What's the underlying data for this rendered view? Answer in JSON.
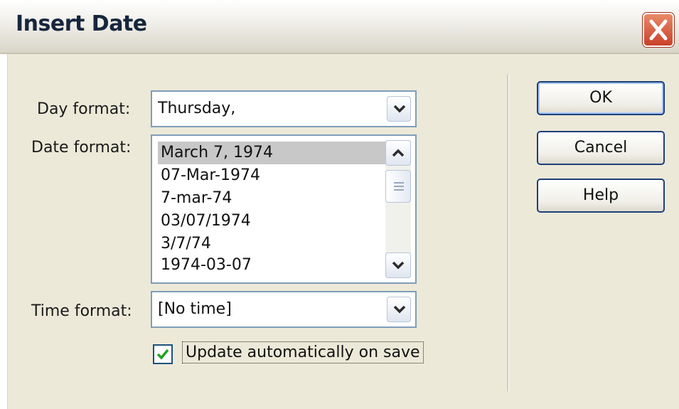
{
  "window": {
    "title": "Insert Date"
  },
  "day_format": {
    "label": "Day format:",
    "value": "Thursday,"
  },
  "date_format": {
    "label": "Date format:",
    "options": [
      "March 7, 1974",
      "07-Mar-1974",
      "7-mar-74",
      "03/07/1974",
      "3/7/74",
      "1974-03-07"
    ],
    "selected": "March 7, 1974"
  },
  "time_format": {
    "label": "Time format:",
    "value": "[No time]"
  },
  "update_auto": {
    "label": "Update automatically on save",
    "checked": true
  },
  "buttons": {
    "ok": "OK",
    "cancel": "Cancel",
    "help": "Help"
  },
  "icons": {
    "close": "close-icon",
    "dropdown": "chevron-down-icon",
    "scroll_up": "chevron-up-icon",
    "check": "checkmark-icon"
  },
  "colors": {
    "close_button": "#c9412b",
    "selection": "#c8c8c8",
    "check": "#21a121",
    "border": "#7f9db9"
  }
}
